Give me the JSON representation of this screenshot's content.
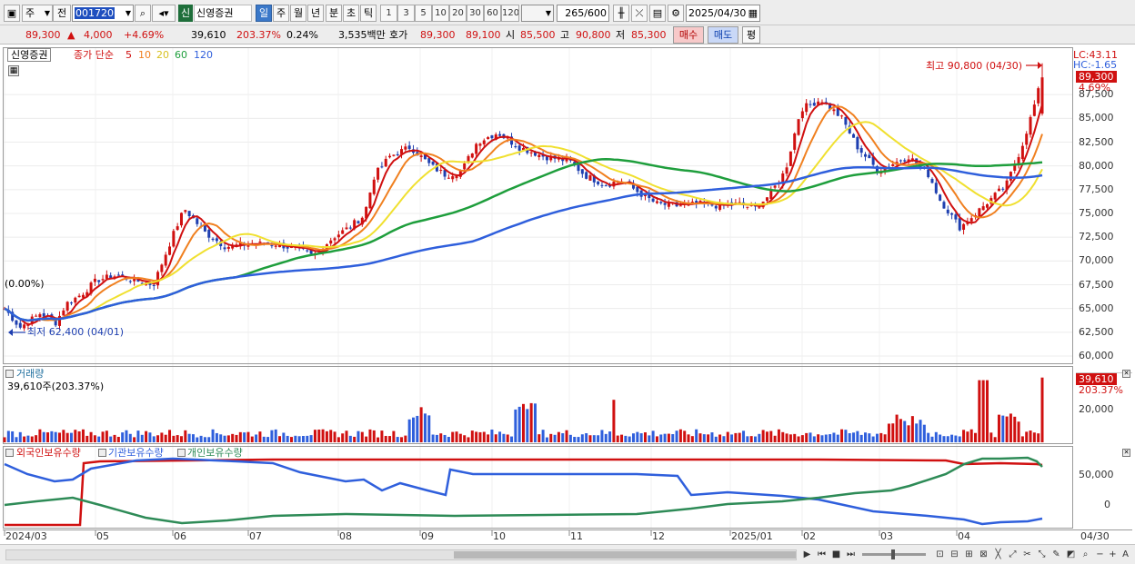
{
  "toolbar": {
    "chart_type": "주",
    "market": "전",
    "code": "001720",
    "name_badge": "신",
    "stock_name": "신영증권",
    "periods": [
      "일",
      "주",
      "월",
      "년",
      "분",
      "초",
      "틱"
    ],
    "active_period": "일",
    "minutes": [
      "1",
      "3",
      "5",
      "10",
      "20",
      "30",
      "60",
      "120"
    ],
    "count_value": "265",
    "count_max": "/600",
    "date": "2025/04/30"
  },
  "quote": {
    "price": "89,300",
    "change": "4,000",
    "change_arrow": "▲",
    "change_pct": "+4.69%",
    "volume": "39,610",
    "volume_ratio": "203.37%",
    "turnover": "0.24%",
    "amount": "3,535백만",
    "ask_label": "호가",
    "ask": "89,300",
    "bid": "89,100",
    "open_label": "시",
    "open": "85,500",
    "high_label": "고",
    "high": "90,800",
    "low_label": "저",
    "low": "85,300",
    "buy": "매수",
    "sell": "매도",
    "eval": "평"
  },
  "price_panel": {
    "name": "신영증권",
    "ma_label": "종가 단순",
    "ma_periods": [
      "5",
      "10",
      "20",
      "60",
      "120"
    ],
    "ma_colors": [
      "#d01010",
      "#f08020",
      "#f0e030",
      "#1e9e3c",
      "#2f5fdc"
    ],
    "lc": "LC:43.11",
    "hc": "HC:-1.65",
    "high_note": "최고 90,800 (04/30)",
    "low_note": "최저 62,400 (04/01)",
    "base_pct": "(0.00%)",
    "last_price_tag": "89,300",
    "last_pct_tag": "4.69%",
    "yticks": [
      "87,500",
      "85,000",
      "82,500",
      "80,000",
      "77,500",
      "75,000",
      "72,500",
      "70,000",
      "67,500",
      "65,000",
      "62,500",
      "60,000"
    ]
  },
  "volume_panel": {
    "title": "거래량",
    "readout": "39,610주(203.37%)",
    "tag": "39,610",
    "tag_pct": "203.37%",
    "ytick": "20,000"
  },
  "holdings_panel": {
    "legend": [
      "외국인보유수량",
      "기관보유수량",
      "개인보유수량"
    ],
    "colors": [
      "#d01010",
      "#2f5fdc",
      "#2e8b57"
    ],
    "yticks": [
      "50,000",
      "0"
    ]
  },
  "xaxis": {
    "labels": [
      "2024/03",
      "05",
      "06",
      "07",
      "08",
      "09",
      "10",
      "11",
      "12",
      "2025/01",
      "02",
      "03",
      "04"
    ],
    "last": "04/30"
  },
  "chart_data": {
    "type": "candlestick",
    "symbol": "신영증권 (001720)",
    "x_range": [
      "2024/03",
      "2025/04/30"
    ],
    "y_range": [
      60000,
      90000
    ],
    "period_high": {
      "value": 90800,
      "date": "04/30"
    },
    "period_low": {
      "value": 62400,
      "date": "04/01"
    },
    "approx_close_by_month": [
      {
        "month": "2024/03",
        "close": 64000
      },
      {
        "month": "05",
        "close": 68500
      },
      {
        "month": "06",
        "close": 72000
      },
      {
        "month": "07",
        "close": 71000
      },
      {
        "month": "08",
        "close": 72500
      },
      {
        "month": "09",
        "close": 80500
      },
      {
        "month": "10",
        "close": 81500
      },
      {
        "month": "11",
        "close": 78500
      },
      {
        "month": "12",
        "close": 75500
      },
      {
        "month": "2025/01",
        "close": 76000
      },
      {
        "month": "02",
        "close": 80000
      },
      {
        "month": "03",
        "close": 80500
      },
      {
        "month": "04",
        "close": 89300
      }
    ],
    "last": {
      "close": 89300,
      "open": 85500,
      "high": 90800,
      "low": 85300,
      "volume": 39610
    }
  }
}
